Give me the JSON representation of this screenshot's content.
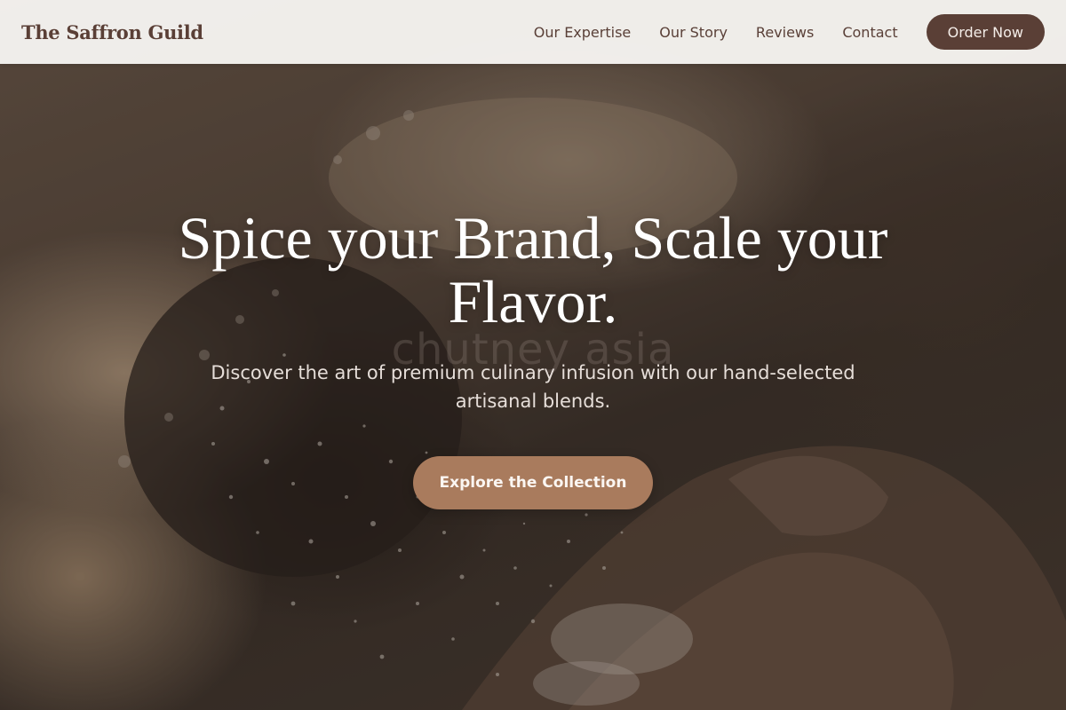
{
  "brand": {
    "name": "The Saffron Guild"
  },
  "nav": {
    "links": [
      {
        "label": "Our Expertise"
      },
      {
        "label": "Our Story"
      },
      {
        "label": "Reviews"
      },
      {
        "label": "Contact"
      }
    ],
    "cta_label": "Order Now"
  },
  "hero": {
    "title": "Spice your Brand, Scale your Flavor.",
    "subtitle": "Discover the art of premium culinary infusion with our hand-selected artisanal blends.",
    "cta_label": "Explore the Collection",
    "watermark": "chutney asia"
  },
  "colors": {
    "brand_brown": "#5a3f36",
    "cta_tan": "#a97b5d",
    "nav_bg": "#f5f3f0"
  }
}
